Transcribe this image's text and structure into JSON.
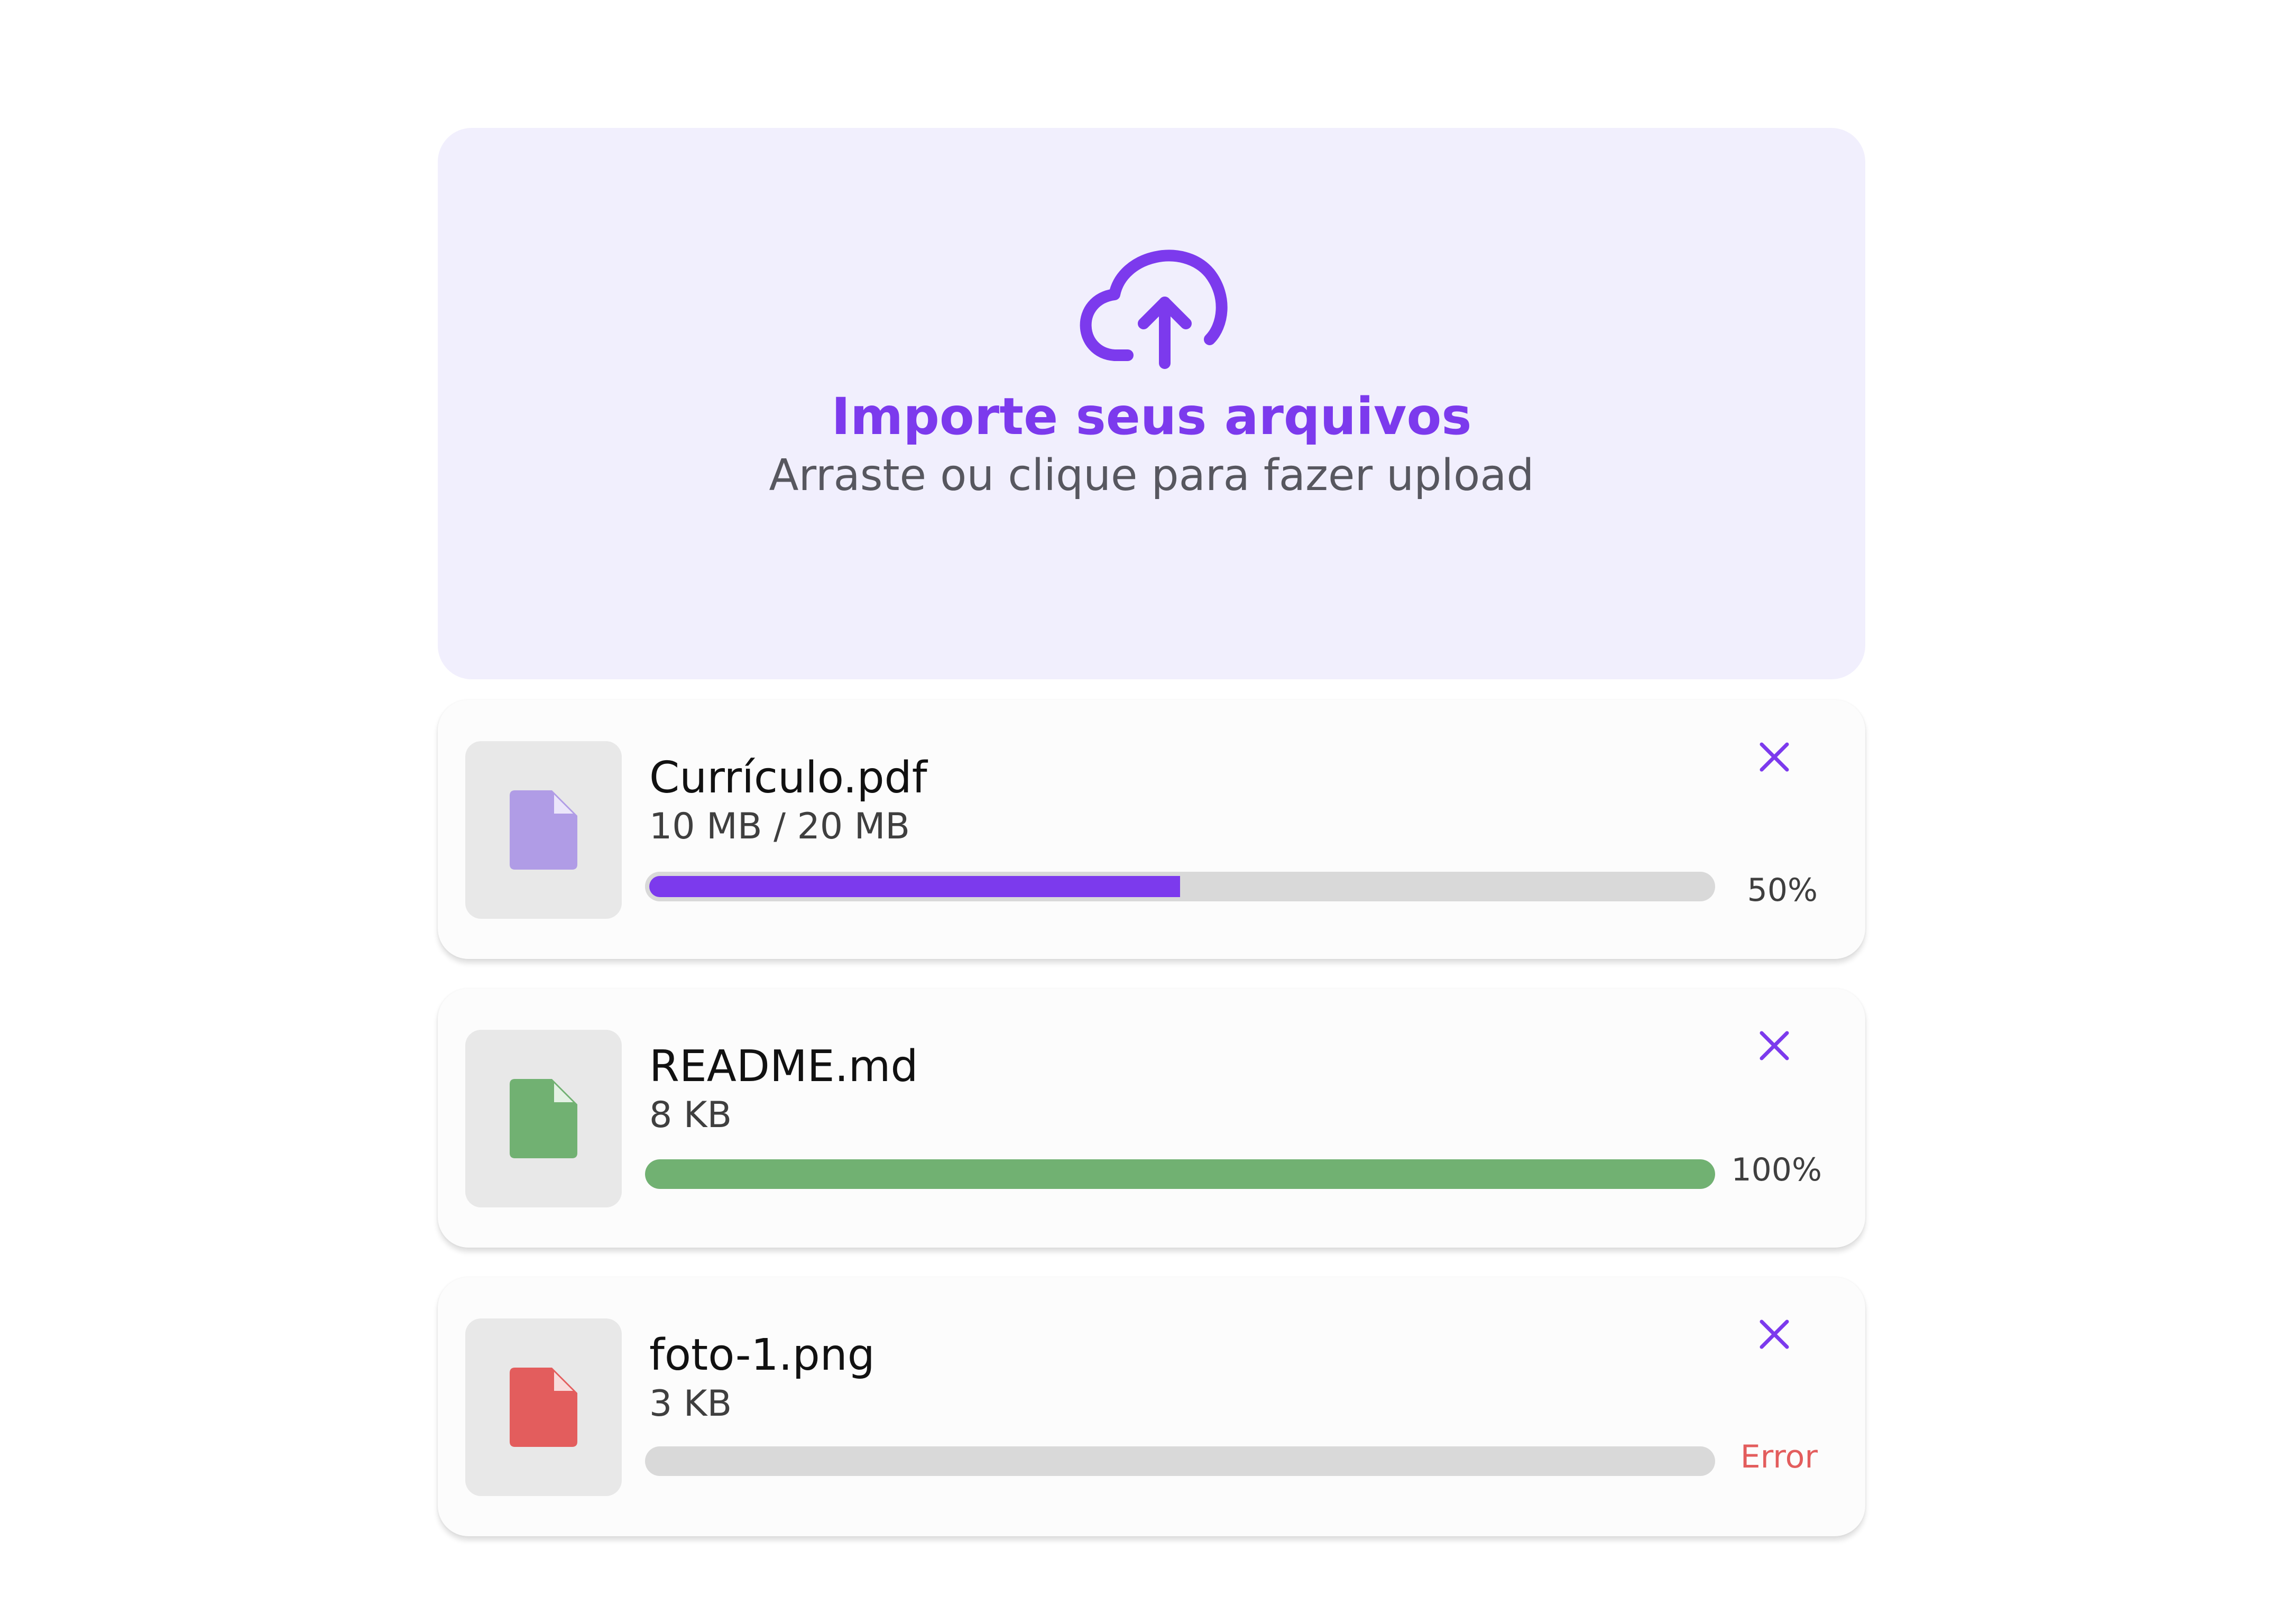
{
  "colors": {
    "accent": "#7c3aed",
    "dropzone_bg": "#f1effd",
    "success": "#71b172",
    "error": "#e35d5d",
    "pdf_icon": "#b09ce6",
    "track": "#d9d9d9"
  },
  "dropzone": {
    "icon": "cloud-upload-icon",
    "title": "Importe seus arquivos",
    "subtitle": "Arraste ou clique para fazer upload"
  },
  "files": [
    {
      "name": "Currículo.pdf",
      "size": "10 MB / 20 MB",
      "progress": 0.5,
      "status": "50%",
      "state": "uploading",
      "icon": "document-icon",
      "icon_color": "#b09ce6"
    },
    {
      "name": "README.md",
      "size": "8 KB",
      "progress": 1.0,
      "status": "100%",
      "state": "done",
      "icon": "document-icon",
      "icon_color": "#71b172"
    },
    {
      "name": "foto-1.png",
      "size": "3 KB",
      "progress": 0,
      "status": "Error",
      "state": "error",
      "icon": "document-icon",
      "icon_color": "#e35d5d"
    }
  ]
}
